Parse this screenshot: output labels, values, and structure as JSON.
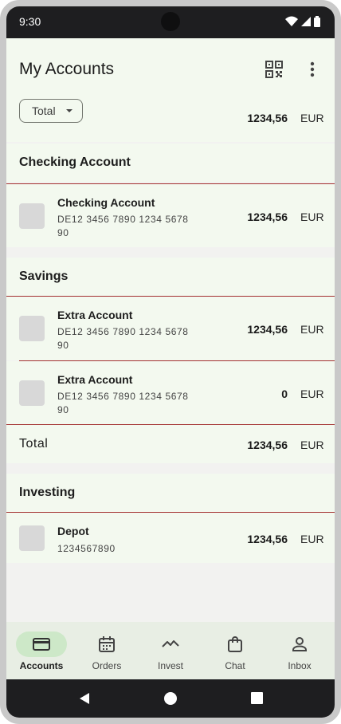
{
  "status_bar": {
    "time": "9:30"
  },
  "app_bar": {
    "title": "My Accounts",
    "qr_icon": "qr-code-icon",
    "more_icon": "more-vert-icon"
  },
  "summary": {
    "filter_label": "Total",
    "amount": "1234,56",
    "currency": "EUR"
  },
  "sections": [
    {
      "title": "Checking Account",
      "accounts": [
        {
          "name": "Checking Account",
          "iban_line1": "DE12 3456 7890 1234 5678",
          "iban_line2": "90",
          "amount": "1234,56",
          "currency": "EUR"
        }
      ]
    },
    {
      "title": "Savings",
      "accounts": [
        {
          "name": "Extra Account",
          "iban_line1": "DE12 3456 7890 1234 5678",
          "iban_line2": "90",
          "amount": "1234,56",
          "currency": "EUR"
        },
        {
          "name": "Extra Account",
          "iban_line1": "DE12 3456 7890 1234 5678",
          "iban_line2": "90",
          "amount": "0",
          "currency": "EUR"
        }
      ],
      "total": {
        "label": "Total",
        "amount": "1234,56",
        "currency": "EUR"
      }
    },
    {
      "title": "Investing",
      "accounts": [
        {
          "name": "Depot",
          "iban_line1": "1234567890",
          "amount": "1234,56",
          "currency": "EUR"
        }
      ]
    }
  ],
  "bottom_nav": [
    {
      "label": "Accounts",
      "icon": "credit-card-icon",
      "active": true
    },
    {
      "label": "Orders",
      "icon": "calendar-icon",
      "active": false
    },
    {
      "label": "Invest",
      "icon": "chart-line-icon",
      "active": false
    },
    {
      "label": "Chat",
      "icon": "shopping-bag-icon",
      "active": false
    },
    {
      "label": "Inbox",
      "icon": "person-icon",
      "active": false
    }
  ],
  "system_nav": {
    "back_icon": "back-triangle-icon",
    "home_icon": "home-circle-icon",
    "recents_icon": "recents-square-icon"
  }
}
